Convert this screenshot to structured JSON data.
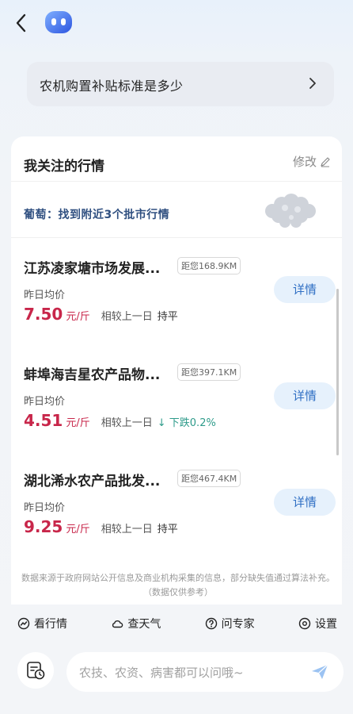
{
  "header": {
    "back_icon": "chevron-left-icon",
    "avatar_icon": "robot-avatar-icon"
  },
  "question": {
    "text": "农机购置补贴标准是多少",
    "chevron_icon": "chevron-right-icon"
  },
  "section": {
    "title": "我关注的行情",
    "modify_label": "修改",
    "modify_icon": "pencil-icon"
  },
  "product_line": "葡萄：找到附近3个批市行情",
  "markets": [
    {
      "name": "江苏凌家塘市场发展...",
      "distance": "距您168.9KM",
      "avg_label": "昨日均价",
      "price": "7.50",
      "unit": "元/斤",
      "compare_label": "相较上一日",
      "trend": "持平",
      "detail_label": "详情"
    },
    {
      "name": "蚌埠海吉星农产品物...",
      "distance": "距您397.1KM",
      "avg_label": "昨日均价",
      "price": "4.51",
      "unit": "元/斤",
      "compare_label": "相较上一日",
      "trend": "↓ 下跌0.2%",
      "detail_label": "详情"
    },
    {
      "name": "湖北浠水农产品批发...",
      "distance": "距您467.4KM",
      "avg_label": "昨日均价",
      "price": "9.25",
      "unit": "元/斤",
      "compare_label": "相较上一日",
      "trend": "持平",
      "detail_label": "详情"
    }
  ],
  "disclaimer": "数据来源于政府网站公开信息及商业机构采集的信息，部分缺失值通过算法补充。（数据仅供参考）",
  "quick_actions": [
    {
      "label": "看行情",
      "icon": "trend-chart-icon"
    },
    {
      "label": "查天气",
      "icon": "cloud-icon"
    },
    {
      "label": "问专家",
      "icon": "question-icon"
    },
    {
      "label": "设置",
      "icon": "gear-icon"
    }
  ],
  "chat": {
    "placeholder": "农技、农资、病害都可以问哦~",
    "send_icon": "send-icon",
    "history_icon": "history-icon"
  },
  "colors": {
    "price": "#c8264a",
    "down": "#2e9b8a",
    "accent": "#2f6fc4"
  }
}
